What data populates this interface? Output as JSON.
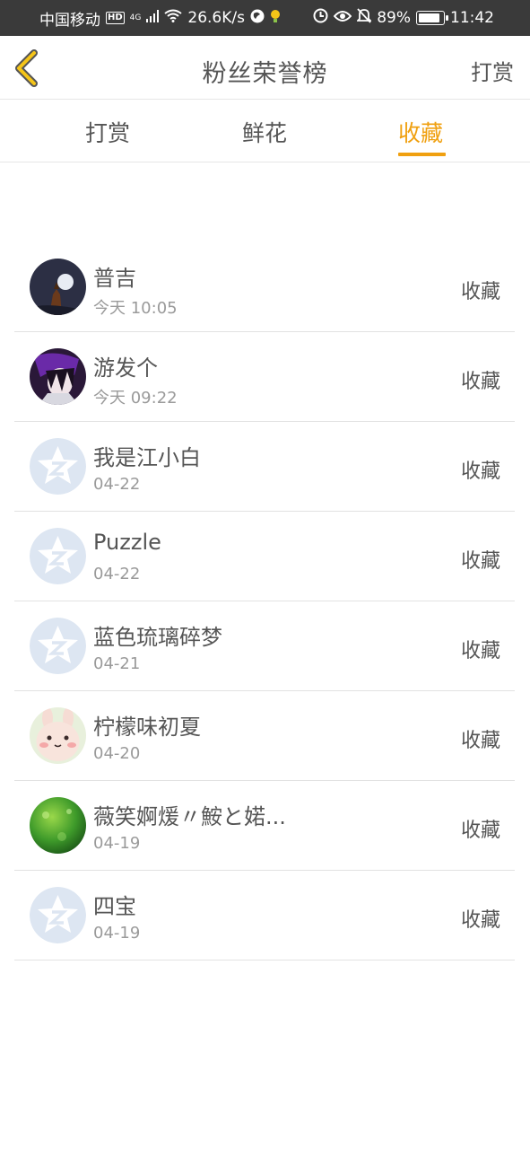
{
  "status_bar": {
    "carrier": "中国移动",
    "hd_badge": "HD",
    "network": "4G",
    "speed": "26.6K/s",
    "battery_percent": "89%",
    "battery_level": 0.89,
    "time": "11:42",
    "icons": [
      "signal-icon",
      "wifi-icon",
      "app-icon",
      "notification-icon",
      "eye-icon",
      "mute-icon",
      "battery-icon"
    ]
  },
  "nav": {
    "title": "粉丝荣誉榜",
    "action": "打赏"
  },
  "tabs": [
    {
      "label": "打赏",
      "active": false
    },
    {
      "label": "鲜花",
      "active": false
    },
    {
      "label": "收藏",
      "active": true
    }
  ],
  "colors": {
    "accent": "#f0a010",
    "status_bar": "#3a3a3a",
    "default_avatar": "#dde6f2"
  },
  "list": [
    {
      "name": "普吉",
      "time": "今天 10:05",
      "action": "收藏",
      "avatar": "moon-night-avatar"
    },
    {
      "name": "游发个",
      "time": "今天 09:22",
      "action": "收藏",
      "avatar": "anime-character-avatar"
    },
    {
      "name": "我是江小白",
      "time": "04-22",
      "action": "收藏",
      "avatar": "default-star-avatar"
    },
    {
      "name": "Puzzle",
      "time": "04-22",
      "action": "收藏",
      "avatar": "default-star-avatar"
    },
    {
      "name": "蓝色琉璃碎梦",
      "time": "04-21",
      "action": "收藏",
      "avatar": "default-star-avatar"
    },
    {
      "name": "柠檬味初夏",
      "time": "04-20",
      "action": "收藏",
      "avatar": "bunny-avatar"
    },
    {
      "name": "薇笑婀煖〃鮟と婼...",
      "time": "04-19",
      "action": "收藏",
      "avatar": "green-bokeh-avatar"
    },
    {
      "name": "四宝",
      "time": "04-19",
      "action": "收藏",
      "avatar": "default-star-avatar"
    }
  ]
}
